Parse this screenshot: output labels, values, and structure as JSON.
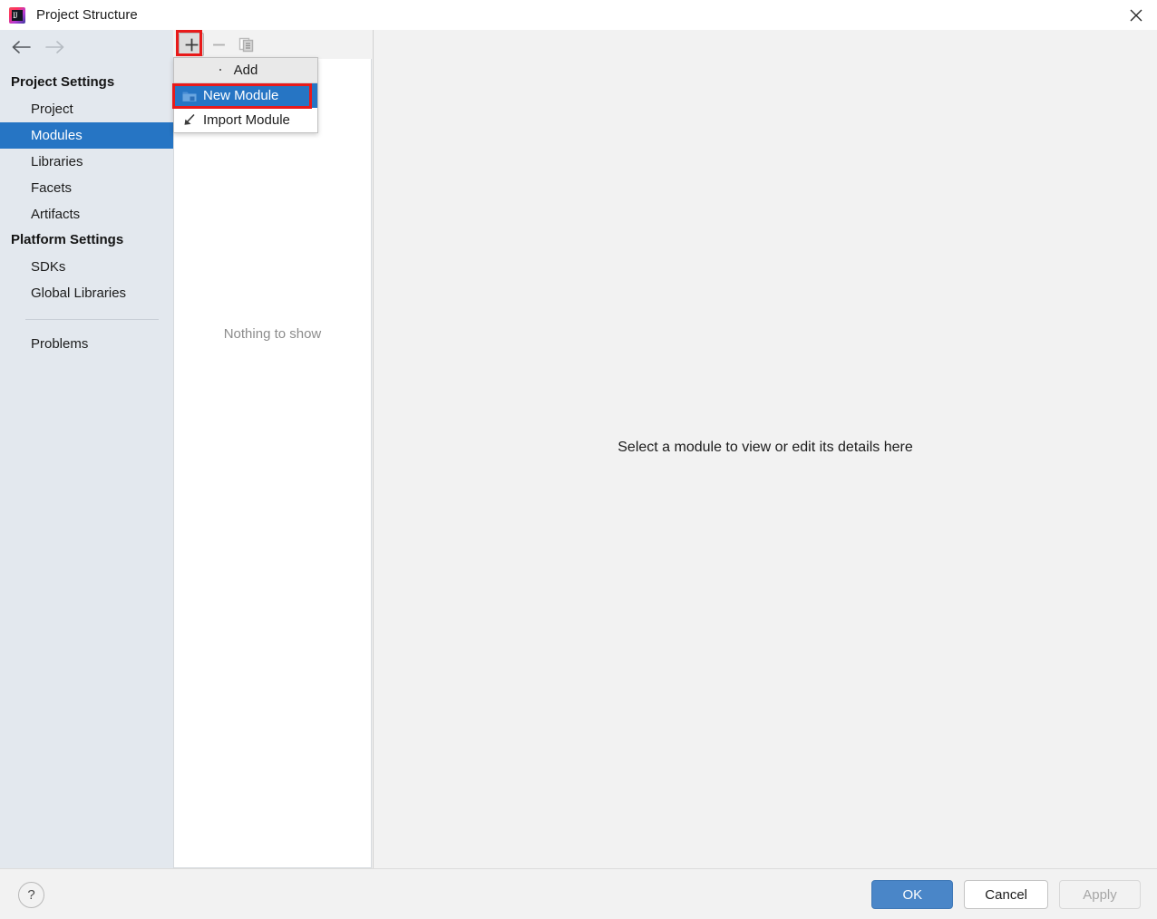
{
  "window": {
    "title": "Project Structure",
    "app_icon": "intellij-idea-icon",
    "close_icon": "close-icon"
  },
  "sidebar": {
    "back_icon": "back-arrow-icon",
    "forward_icon": "forward-arrow-icon",
    "groups": [
      {
        "header": "Project Settings",
        "items": [
          {
            "label": "Project",
            "selected": false
          },
          {
            "label": "Modules",
            "selected": true
          },
          {
            "label": "Libraries",
            "selected": false
          },
          {
            "label": "Facets",
            "selected": false
          },
          {
            "label": "Artifacts",
            "selected": false
          }
        ]
      },
      {
        "header": "Platform Settings",
        "items": [
          {
            "label": "SDKs",
            "selected": false
          },
          {
            "label": "Global Libraries",
            "selected": false
          }
        ]
      }
    ],
    "problems_label": "Problems"
  },
  "middle": {
    "toolbar": {
      "add_icon": "plus-icon",
      "remove_icon": "minus-icon",
      "copy_icon": "copy-icon"
    },
    "empty_text": "Nothing to show"
  },
  "popup_menu": {
    "header": "Add",
    "items": [
      {
        "label": "New Module",
        "icon": "new-module-folder-icon",
        "selected": true
      },
      {
        "label": "Import Module",
        "icon": "import-module-arrow-icon",
        "selected": false
      }
    ]
  },
  "right": {
    "hint": "Select a module to view or edit its details here"
  },
  "bottom": {
    "help_label": "?",
    "ok_label": "OK",
    "cancel_label": "Cancel",
    "apply_label": "Apply"
  },
  "colors": {
    "selection_blue": "#2675c4",
    "primary_button": "#4a86c8",
    "annotation_red": "#e81a1a",
    "sidebar_bg": "#e3e8ee",
    "panel_bg": "#f2f2f2"
  }
}
